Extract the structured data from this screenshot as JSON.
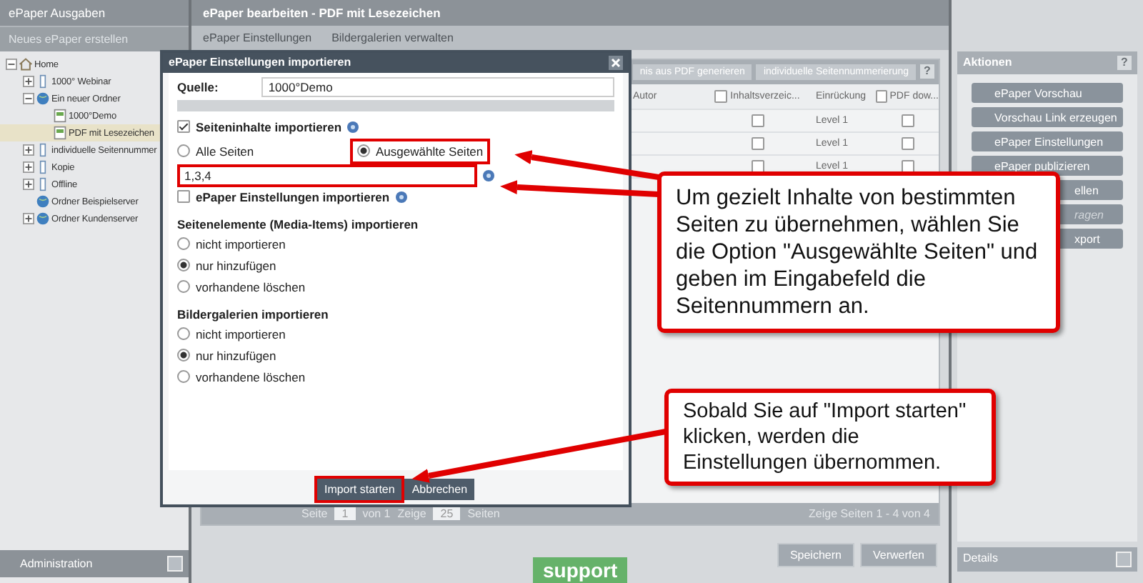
{
  "sidebar": {
    "title": "ePaper Ausgaben",
    "new_button": "Neues ePaper erstellen",
    "tree": [
      {
        "label": "Home",
        "kind": "home",
        "expanded": true,
        "selected": false,
        "children": [
          {
            "label": "1000° Webinar",
            "kind": "epaper",
            "expanded": false,
            "selected": false
          },
          {
            "label": "Ein neuer Ordner",
            "kind": "server",
            "expanded": true,
            "selected": false,
            "children": [
              {
                "label": "1000°Demo",
                "kind": "doc",
                "selected": false
              },
              {
                "label": "PDF mit Lesezeichen",
                "kind": "doc",
                "selected": true
              }
            ]
          },
          {
            "label": "individuelle Seitennummer",
            "kind": "epaper",
            "expanded": false,
            "selected": false
          },
          {
            "label": "Kopie",
            "kind": "epaper",
            "expanded": false,
            "selected": false
          },
          {
            "label": "Offline",
            "kind": "epaper",
            "expanded": false,
            "selected": false
          },
          {
            "label": "Ordner Beispielserver",
            "kind": "server",
            "selected": false
          },
          {
            "label": "Ordner Kundenserver",
            "kind": "server",
            "expanded": false,
            "selected": false
          }
        ]
      }
    ],
    "footer": "Administration"
  },
  "editor": {
    "title": "ePaper bearbeiten - PDF mit Lesezeichen",
    "toolbar": [
      "ePaper Einstellungen",
      "Bildergalerien verwalten"
    ],
    "grid_toolbar": [
      "nis aus PDF generieren",
      "individuelle Seitennummerierung"
    ],
    "columns": [
      "Autor",
      "Inhaltsverzeic...",
      "Einrückung",
      "PDF dow..."
    ],
    "header_checks": {
      "toc": false,
      "pdf": false
    },
    "rows": [
      {
        "toc": false,
        "level": "Level 1",
        "pdf": false
      },
      {
        "toc": false,
        "level": "Level 1",
        "pdf": false
      },
      {
        "toc": false,
        "level": "Level 1",
        "pdf": false
      }
    ],
    "paging": {
      "page_label": "Seite",
      "page": "1",
      "of": "von 1",
      "show_label": "Zeige",
      "per_page": "25",
      "pages_label": "Seiten",
      "summary": "Zeige Seiten 1 - 4 von 4"
    },
    "support": "support",
    "buttons": [
      "Speichern",
      "Verwerfen"
    ],
    "help": "?"
  },
  "actions": {
    "title": "Aktionen",
    "buttons": [
      {
        "label": "ePaper Vorschau",
        "disabled": false
      },
      {
        "label": "Vorschau Link erzeugen",
        "disabled": false
      },
      {
        "label": "ePaper Einstellungen",
        "disabled": false
      },
      {
        "label": "ePaper publizieren",
        "disabled": false
      },
      {
        "label": "ellen",
        "disabled": false
      },
      {
        "label": "ragen",
        "disabled": true
      },
      {
        "label": "xport",
        "disabled": false
      }
    ],
    "details": "Details",
    "help": "?"
  },
  "dialog": {
    "title": "ePaper Einstellungen importieren",
    "source_label": "Quelle:",
    "source": "1000°Demo",
    "content_import": {
      "label": "Seiteninhalte importieren",
      "checked": true
    },
    "page_options": [
      {
        "label": "Alle Seiten",
        "selected": false
      },
      {
        "label": "Ausgewählte Seiten",
        "selected": true
      }
    ],
    "pages": "1,3,4",
    "settings_import": {
      "label": "ePaper Einstellungen importieren",
      "checked": false
    },
    "groups": [
      {
        "title": "Seitenelemente (Media-Items) importieren",
        "options": [
          {
            "label": "nicht importieren",
            "selected": false
          },
          {
            "label": "nur hinzufügen",
            "selected": true
          },
          {
            "label": "vorhandene löschen",
            "selected": false
          }
        ]
      },
      {
        "title": "Bildergalerien importieren",
        "options": [
          {
            "label": "nicht importieren",
            "selected": false
          },
          {
            "label": "nur hinzufügen",
            "selected": true
          },
          {
            "label": "vorhandene löschen",
            "selected": false
          }
        ]
      }
    ],
    "buttons": [
      "Import starten",
      "Abbrechen"
    ]
  },
  "callouts": [
    "Um gezielt Inhalte von bestimmten Seiten zu übernehmen, wählen Sie die Option \"Ausgewählte Seiten\" und geben im Eingabefeld die Seitennummern an.",
    "Sobald Sie auf \"Import starten\" klicken, werden die Einstellungen übernommen."
  ]
}
